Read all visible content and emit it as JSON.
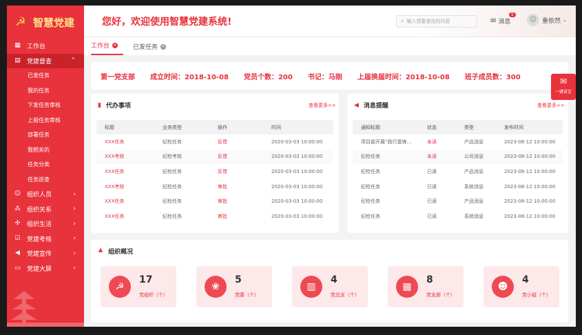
{
  "app": {
    "title": "智慧党建"
  },
  "header": {
    "welcome": "您好，欢迎使用智慧党建系统!",
    "search_placeholder": "输入想要查找的内容",
    "message_label": "消息",
    "message_badge": "5",
    "user_name": "重依然"
  },
  "sidebar": {
    "items": [
      {
        "label": "工作台",
        "icon": "grid-icon"
      },
      {
        "label": "党建督查",
        "icon": "document-icon",
        "expanded": true
      },
      {
        "label": "组织人员",
        "icon": "people-icon"
      },
      {
        "label": "组织关系",
        "icon": "relation-icon"
      },
      {
        "label": "组织生活",
        "icon": "life-icon"
      },
      {
        "label": "党建考核",
        "icon": "check-icon"
      },
      {
        "label": "党建宣传",
        "icon": "megaphone-icon"
      },
      {
        "label": "党建大屏",
        "icon": "screen-icon"
      }
    ],
    "sub_items": [
      "已发任务",
      "我的任务",
      "下发任务审核",
      "上报任务审核",
      "部署任务",
      "我相关的",
      "任务分类",
      "任务巡查"
    ]
  },
  "tabs": [
    {
      "label": "工作台",
      "active": true
    },
    {
      "label": "已发任务",
      "active": false
    }
  ],
  "info": {
    "branch": "第一党支部",
    "founded": "成立时间：2018-10-08",
    "members": "党员个数：200",
    "secretary": "书记：马刚",
    "last_election": "上届换届时间：2018-10-08",
    "team_size": "班子成员数：300"
  },
  "todo": {
    "title": "代办事项",
    "more": "查看更多>>",
    "columns": [
      "标题",
      "业务类型",
      "操作",
      "时间"
    ],
    "rows": [
      [
        "XXX任务",
        "纪检任务",
        "反馈",
        "2020-03-03  10:00:00"
      ],
      [
        "XXX考核",
        "纪检考核",
        "反馈",
        "2020-03-03  10:00:00"
      ],
      [
        "XXX任务",
        "纪检任务",
        "反馈",
        "2020-03-03  10:00:00"
      ],
      [
        "XXX考核",
        "纪检任务",
        "审批",
        "2020-03-03  10:00:00"
      ],
      [
        "XXX任务",
        "纪检任务",
        "审批",
        "2020-03-03  10:00:00"
      ],
      [
        "XXX任务",
        "纪检任务",
        "审批",
        "2020-03-03  10:00:00"
      ]
    ]
  },
  "notice": {
    "title": "消息提醒",
    "more": "查看更多>>",
    "columns": [
      "通知标题",
      "状态",
      "类型",
      "发布时间"
    ],
    "rows": [
      [
        "项目部开展“践行雷锋…",
        "未读",
        "产品消息",
        "2023-08-12  10:00:00"
      ],
      [
        "纪检任务",
        "未读",
        "公司消息",
        "2023-08-12  10:00:00"
      ],
      [
        "纪检任务",
        "已读",
        "产品消息",
        "2023-08-12  10:00:00"
      ],
      [
        "纪检任务",
        "已读",
        "系统消息",
        "2023-08-12  10:00:00"
      ],
      [
        "纪检任务",
        "已读",
        "产品消息",
        "2023-08-12  10:00:00"
      ],
      [
        "纪检任务",
        "已读",
        "系统消息",
        "2023-08-12  10:00:00"
      ]
    ]
  },
  "org": {
    "title": "组织概况",
    "stats": [
      {
        "value": "17",
        "label": "党组织（个）",
        "icon": "party-emblem-icon"
      },
      {
        "value": "5",
        "label": "党委（个）",
        "icon": "committee-icon"
      },
      {
        "value": "4",
        "label": "党总支（个）",
        "icon": "building-icon"
      },
      {
        "value": "8",
        "label": "党支部（个）",
        "icon": "branch-icon"
      },
      {
        "value": "4",
        "label": "党小组（个）",
        "icon": "group-icon"
      }
    ]
  },
  "float_button": {
    "label": "一键讲言"
  },
  "colors": {
    "accent": "#e8323c",
    "accent_dark": "#c9222b",
    "sidebar": "#e8323c"
  }
}
